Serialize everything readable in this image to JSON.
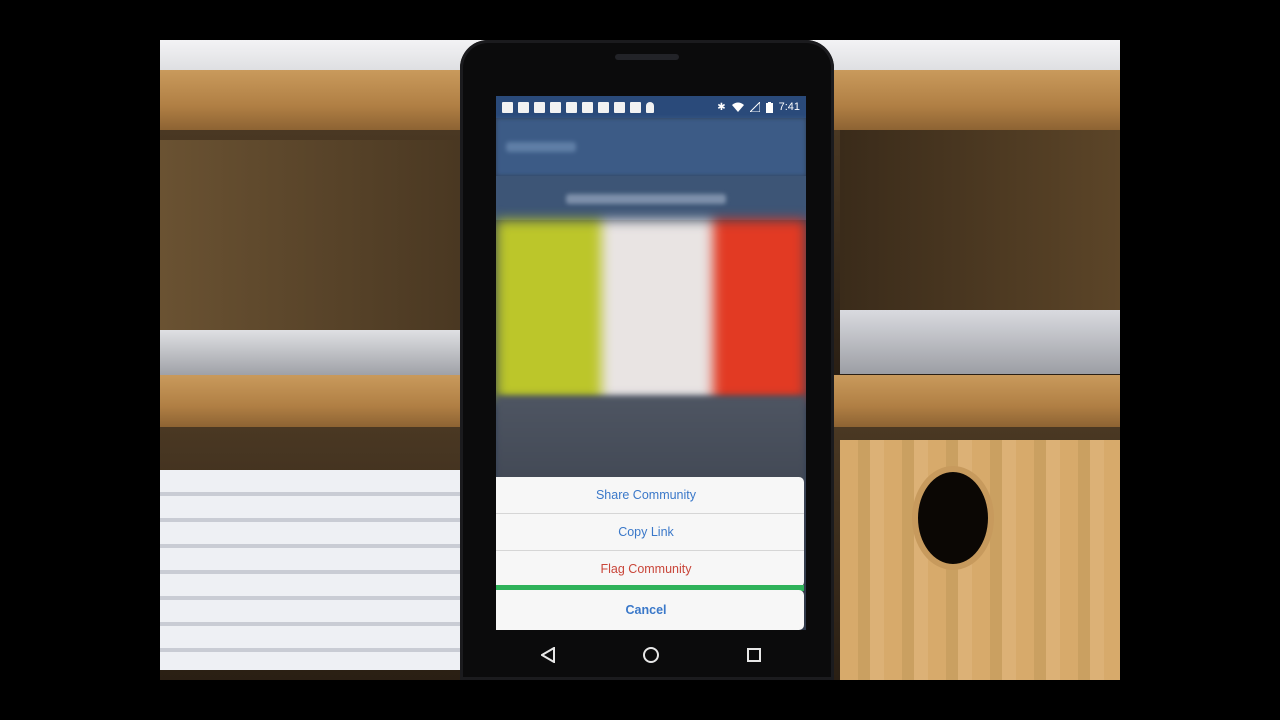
{
  "status_bar": {
    "time": "7:41",
    "notification_icons": [
      "facebook-icon",
      "facebook-icon",
      "facebook-icon",
      "facebook-icon",
      "facebook-icon",
      "facebook-icon",
      "facebook-icon",
      "facebook-icon",
      "facebook-icon",
      "person-icon"
    ],
    "system_icons": [
      "bluetooth-icon",
      "wifi-icon",
      "signal-icon",
      "battery-icon"
    ]
  },
  "action_sheet": {
    "items": [
      {
        "label": "Share Community",
        "style": "default"
      },
      {
        "label": "Copy Link",
        "style": "default"
      },
      {
        "label": "Flag Community",
        "style": "destructive"
      }
    ],
    "cancel_label": "Cancel"
  },
  "nav_bar": {
    "buttons": [
      "back-icon",
      "home-icon",
      "recents-icon"
    ]
  },
  "colors": {
    "accent_blue": "#3a78c9",
    "destructive_red": "#c9463a",
    "status_bar": "#2a4a7a"
  }
}
